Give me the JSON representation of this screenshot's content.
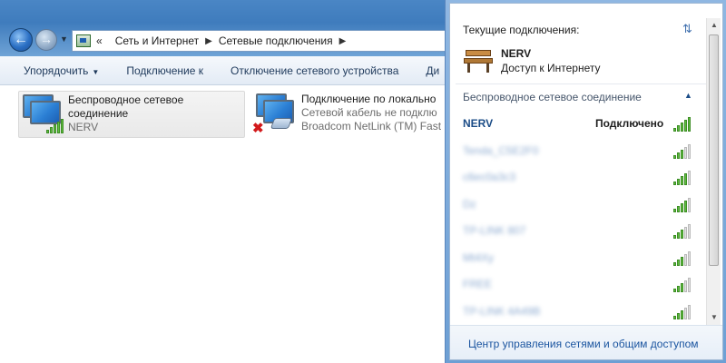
{
  "explorer": {
    "address": {
      "prefix": "«",
      "crumbs": [
        "Сеть и Интернет",
        "Сетевые подключения"
      ]
    },
    "toolbar": {
      "organize": "Упорядочить",
      "connect": "Подключение к",
      "disconnect": "Отключение сетевого устройства",
      "more": "Ди"
    },
    "connections": [
      {
        "name1": "Беспроводное сетевое",
        "name2": "соединение",
        "sub": "NERV"
      },
      {
        "name1": "Подключение по локально",
        "name2": "Сетевой кабель не подклю",
        "sub": "Broadcom NetLink (TM) Fast"
      }
    ]
  },
  "flyout": {
    "header": "Текущие подключения:",
    "current": {
      "name": "NERV",
      "status": "Доступ к Интернету"
    },
    "section_title": "Беспроводное сетевое соединение",
    "networks": [
      {
        "name": "NERV",
        "status": "Подключено",
        "signal": 5
      },
      {
        "name": "Tenda_C5E2F0",
        "signal": 3
      },
      {
        "name": "c6ec0a3c3",
        "signal": 4
      },
      {
        "name": "Dz",
        "signal": 4
      },
      {
        "name": "TP-LINK 807",
        "signal": 3
      },
      {
        "name": "Mt4Xy",
        "signal": 3
      },
      {
        "name": "FREE",
        "signal": 3
      },
      {
        "name": "TP-LINK 4A49B",
        "signal": 3
      }
    ],
    "footer_link": "Центр управления сетями и общим доступом"
  },
  "colors": {
    "title_bar": "#3f7cbd",
    "link": "#1b4c87",
    "signal_green": "#5fbf3f",
    "error_red": "#d2191b"
  },
  "icons": {
    "back": "back-arrow-icon",
    "forward": "forward-arrow-icon",
    "refresh": "refresh-icon",
    "network_bench": "network-bench-icon",
    "collapse": "chevron-up-icon"
  }
}
